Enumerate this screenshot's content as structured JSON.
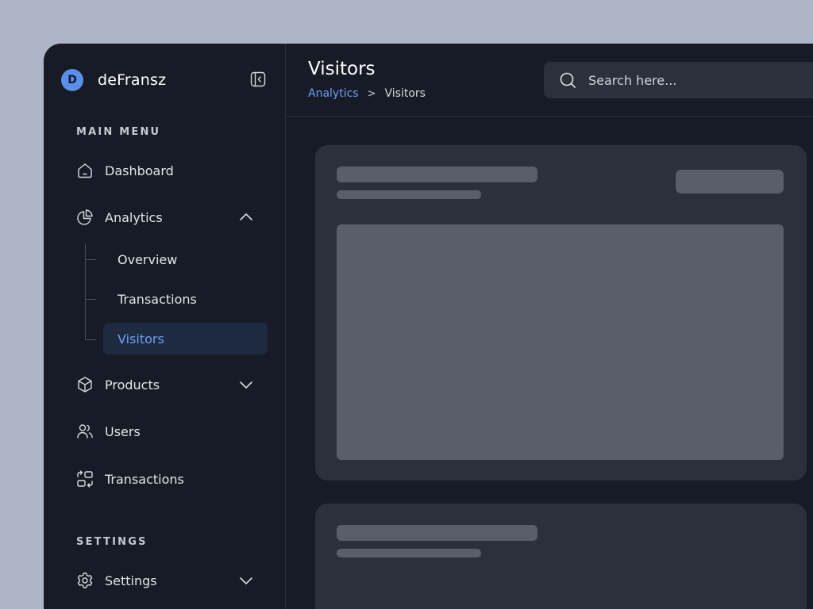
{
  "brand": {
    "initial": "D",
    "name": "deFransz"
  },
  "sidebar": {
    "main_menu_label": "MAIN MENU",
    "settings_label": "SETTINGS",
    "items": {
      "dashboard": {
        "label": "Dashboard",
        "icon": "home-icon"
      },
      "analytics": {
        "label": "Analytics",
        "icon": "pie-chart-icon",
        "expanded": true
      },
      "products": {
        "label": "Products",
        "icon": "box-icon",
        "expanded": false
      },
      "users": {
        "label": "Users",
        "icon": "users-icon"
      },
      "transactions": {
        "label": "Transactions",
        "icon": "transactions-icon"
      },
      "settings": {
        "label": "Settings",
        "icon": "gear-icon",
        "expanded": false
      }
    },
    "analytics_sub": [
      {
        "label": "Overview",
        "active": false
      },
      {
        "label": "Transactions",
        "active": false
      },
      {
        "label": "Visitors",
        "active": true
      }
    ]
  },
  "header": {
    "title": "Visitors",
    "breadcrumb": {
      "parent": "Analytics",
      "separator": ">",
      "current": "Visitors"
    }
  },
  "search": {
    "placeholder": "Search here..."
  },
  "colors": {
    "accent": "#6aa0f2",
    "sidebar_bg": "#171b26",
    "card_bg": "#2c303b",
    "skeleton": "#5a5e68",
    "page_bg": "#adb5c7"
  }
}
